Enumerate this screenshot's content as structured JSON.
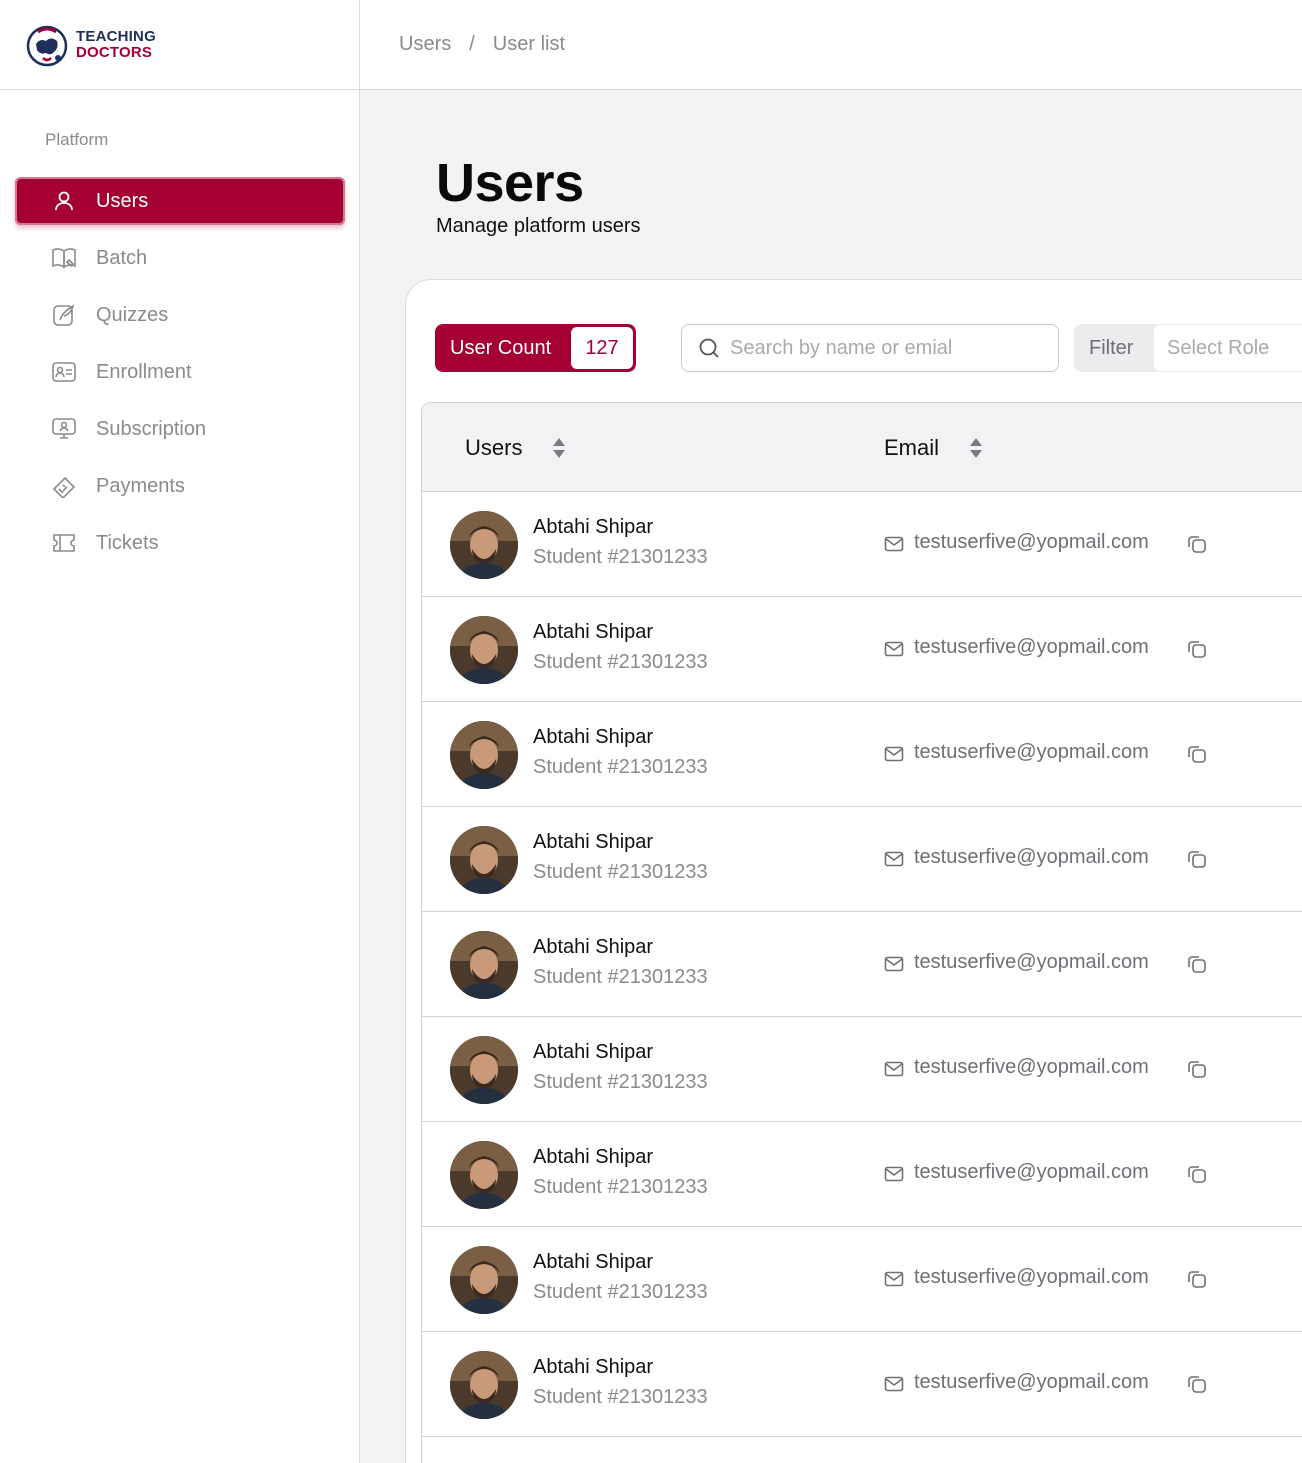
{
  "brand": {
    "line1": "TEACHING",
    "line2": "DOCTORS",
    "primary_color": "#a50034",
    "navy_color": "#1e2f5c"
  },
  "breadcrumb": {
    "items": [
      "Users",
      "User list"
    ],
    "separator": "/"
  },
  "sidebar": {
    "section_label": "Platform",
    "items": [
      {
        "label": "Users",
        "icon": "user-icon",
        "active": true
      },
      {
        "label": "Batch",
        "icon": "book-icon",
        "active": false
      },
      {
        "label": "Quizzes",
        "icon": "quiz-icon",
        "active": false
      },
      {
        "label": "Enrollment",
        "icon": "id-card-icon",
        "active": false
      },
      {
        "label": "Subscription",
        "icon": "subscription-icon",
        "active": false
      },
      {
        "label": "Payments",
        "icon": "payment-icon",
        "active": false
      },
      {
        "label": "Tickets",
        "icon": "ticket-icon",
        "active": false
      }
    ]
  },
  "header": {
    "title": "Users",
    "subtitle": "Manage platform users"
  },
  "toolbar": {
    "user_count_label": "User Count",
    "user_count_value": "127",
    "search_placeholder": "Search by name or emial",
    "filter_label": "Filter",
    "role_placeholder": "Select Role"
  },
  "table": {
    "columns": [
      "Users",
      "Email"
    ],
    "rows": [
      {
        "name": "Abtahi Shipar",
        "id": "Student #21301233",
        "email": "testuserfive@yopmail.com"
      },
      {
        "name": "Abtahi Shipar",
        "id": "Student #21301233",
        "email": "testuserfive@yopmail.com"
      },
      {
        "name": "Abtahi Shipar",
        "id": "Student #21301233",
        "email": "testuserfive@yopmail.com"
      },
      {
        "name": "Abtahi Shipar",
        "id": "Student #21301233",
        "email": "testuserfive@yopmail.com"
      },
      {
        "name": "Abtahi Shipar",
        "id": "Student #21301233",
        "email": "testuserfive@yopmail.com"
      },
      {
        "name": "Abtahi Shipar",
        "id": "Student #21301233",
        "email": "testuserfive@yopmail.com"
      },
      {
        "name": "Abtahi Shipar",
        "id": "Student #21301233",
        "email": "testuserfive@yopmail.com"
      },
      {
        "name": "Abtahi Shipar",
        "id": "Student #21301233",
        "email": "testuserfive@yopmail.com"
      },
      {
        "name": "Abtahi Shipar",
        "id": "Student #21301233",
        "email": "testuserfive@yopmail.com"
      }
    ]
  }
}
